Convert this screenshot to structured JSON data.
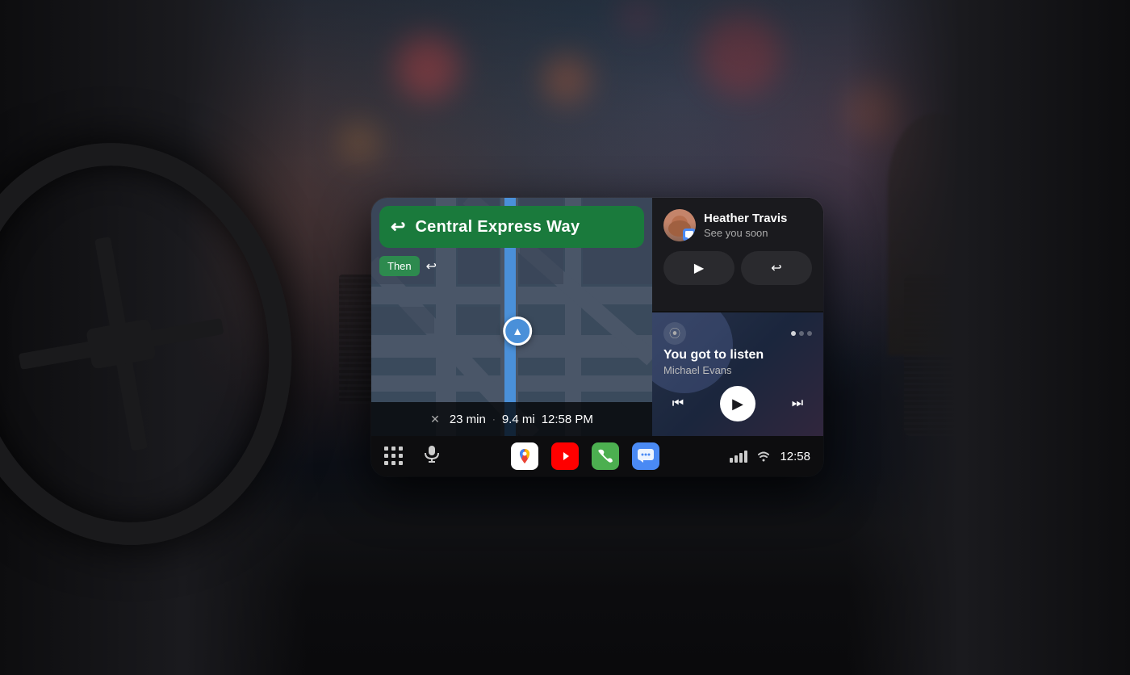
{
  "background": {
    "desc": "Car interior at night with city lights bokeh"
  },
  "android_auto": {
    "navigation": {
      "street_name": "Central Express Way",
      "then_label": "Then",
      "eta_minutes": "23 min",
      "eta_distance": "9.4 mi",
      "eta_time": "12:58 PM"
    },
    "message": {
      "contact_name": "Heather Travis",
      "message_preview": "See you soon",
      "reply_button": "Reply",
      "play_button": "Play"
    },
    "music": {
      "title": "You got to listen",
      "artist": "Michael Evans"
    },
    "bottom_nav": {
      "time": "12:58",
      "apps_icon": "⊞",
      "mic_icon": "🎤"
    }
  }
}
